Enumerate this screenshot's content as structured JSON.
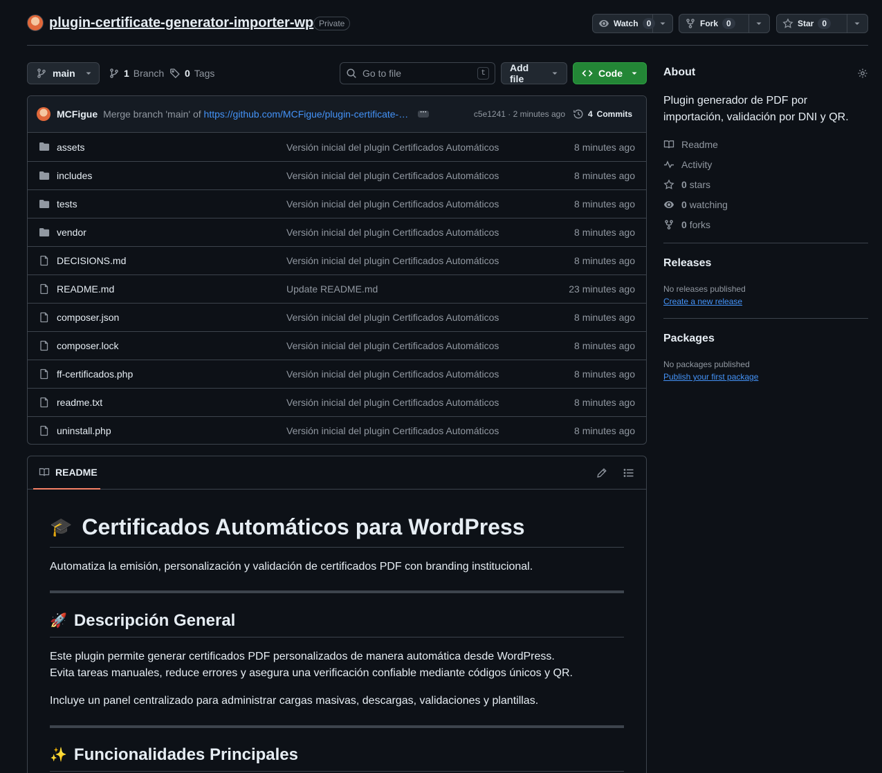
{
  "repo": {
    "name": "plugin-certificate-generator-importer-wp",
    "visibility": "Private",
    "watch_label": "Watch",
    "watch_count": "0",
    "fork_label": "Fork",
    "fork_count": "0",
    "star_label": "Star",
    "star_count": "0"
  },
  "toolbar": {
    "branch": "main",
    "branch_count": "1",
    "branch_label": "Branch",
    "tag_count": "0",
    "tag_label": "Tags",
    "search_placeholder": "Go to file",
    "search_shortcut": "t",
    "add_file_label": "Add file",
    "code_label": "Code"
  },
  "latest_commit": {
    "author": "MCFigue",
    "message_prefix": "Merge branch 'main' of",
    "message_link": "https://github.com/MCFigue/plugin-certificate-…",
    "hash_time": "c5e1241 · 2 minutes ago",
    "commits_count": "4",
    "commits_label": "Commits"
  },
  "files": [
    {
      "type": "folder",
      "name": "assets",
      "message": "Versión inicial del plugin Certificados Automáticos",
      "time": "8 minutes ago"
    },
    {
      "type": "folder",
      "name": "includes",
      "message": "Versión inicial del plugin Certificados Automáticos",
      "time": "8 minutes ago"
    },
    {
      "type": "folder",
      "name": "tests",
      "message": "Versión inicial del plugin Certificados Automáticos",
      "time": "8 minutes ago"
    },
    {
      "type": "folder",
      "name": "vendor",
      "message": "Versión inicial del plugin Certificados Automáticos",
      "time": "8 minutes ago"
    },
    {
      "type": "file",
      "name": "DECISIONS.md",
      "message": "Versión inicial del plugin Certificados Automáticos",
      "time": "8 minutes ago"
    },
    {
      "type": "file",
      "name": "README.md",
      "message": "Update README.md",
      "time": "23 minutes ago"
    },
    {
      "type": "file",
      "name": "composer.json",
      "message": "Versión inicial del plugin Certificados Automáticos",
      "time": "8 minutes ago"
    },
    {
      "type": "file",
      "name": "composer.lock",
      "message": "Versión inicial del plugin Certificados Automáticos",
      "time": "8 minutes ago"
    },
    {
      "type": "file",
      "name": "ff-certificados.php",
      "message": "Versión inicial del plugin Certificados Automáticos",
      "time": "8 minutes ago"
    },
    {
      "type": "file",
      "name": "readme.txt",
      "message": "Versión inicial del plugin Certificados Automáticos",
      "time": "8 minutes ago"
    },
    {
      "type": "file",
      "name": "uninstall.php",
      "message": "Versión inicial del plugin Certificados Automáticos",
      "time": "8 minutes ago"
    }
  ],
  "readme": {
    "tab_label": "README",
    "h1_emoji": "🎓",
    "h1": "Certificados Automáticos para WordPress",
    "intro": "Automatiza la emisión, personalización y validación de certificados PDF con branding institucional.",
    "h2_1_emoji": "🚀",
    "h2_1": "Descripción General",
    "desc_line1": "Este plugin permite generar certificados PDF personalizados de manera automática desde WordPress.",
    "desc_line2": "Evita tareas manuales, reduce errores y asegura una verificación confiable mediante códigos únicos y QR.",
    "desc_para2": "Incluye un panel centralizado para administrar cargas masivas, descargas, validaciones y plantillas.",
    "h2_2_emoji": "✨",
    "h2_2": "Funcionalidades Principales"
  },
  "about": {
    "title": "About",
    "description": "Plugin generador de PDF por importación, validación por DNI y QR.",
    "readme_label": "Readme",
    "activity_label": "Activity",
    "stars_count": "0",
    "stars_label": "stars",
    "watching_count": "0",
    "watching_label": "watching",
    "forks_count": "0",
    "forks_label": "forks"
  },
  "releases": {
    "title": "Releases",
    "empty": "No releases published",
    "link": "Create a new release"
  },
  "packages": {
    "title": "Packages",
    "empty": "No packages published",
    "link": "Publish your first package"
  },
  "colors": {
    "background": "#0d1117",
    "border": "#3d444d",
    "link": "#4493f8",
    "code_button": "#238636",
    "tab_underline": "#f78166"
  }
}
